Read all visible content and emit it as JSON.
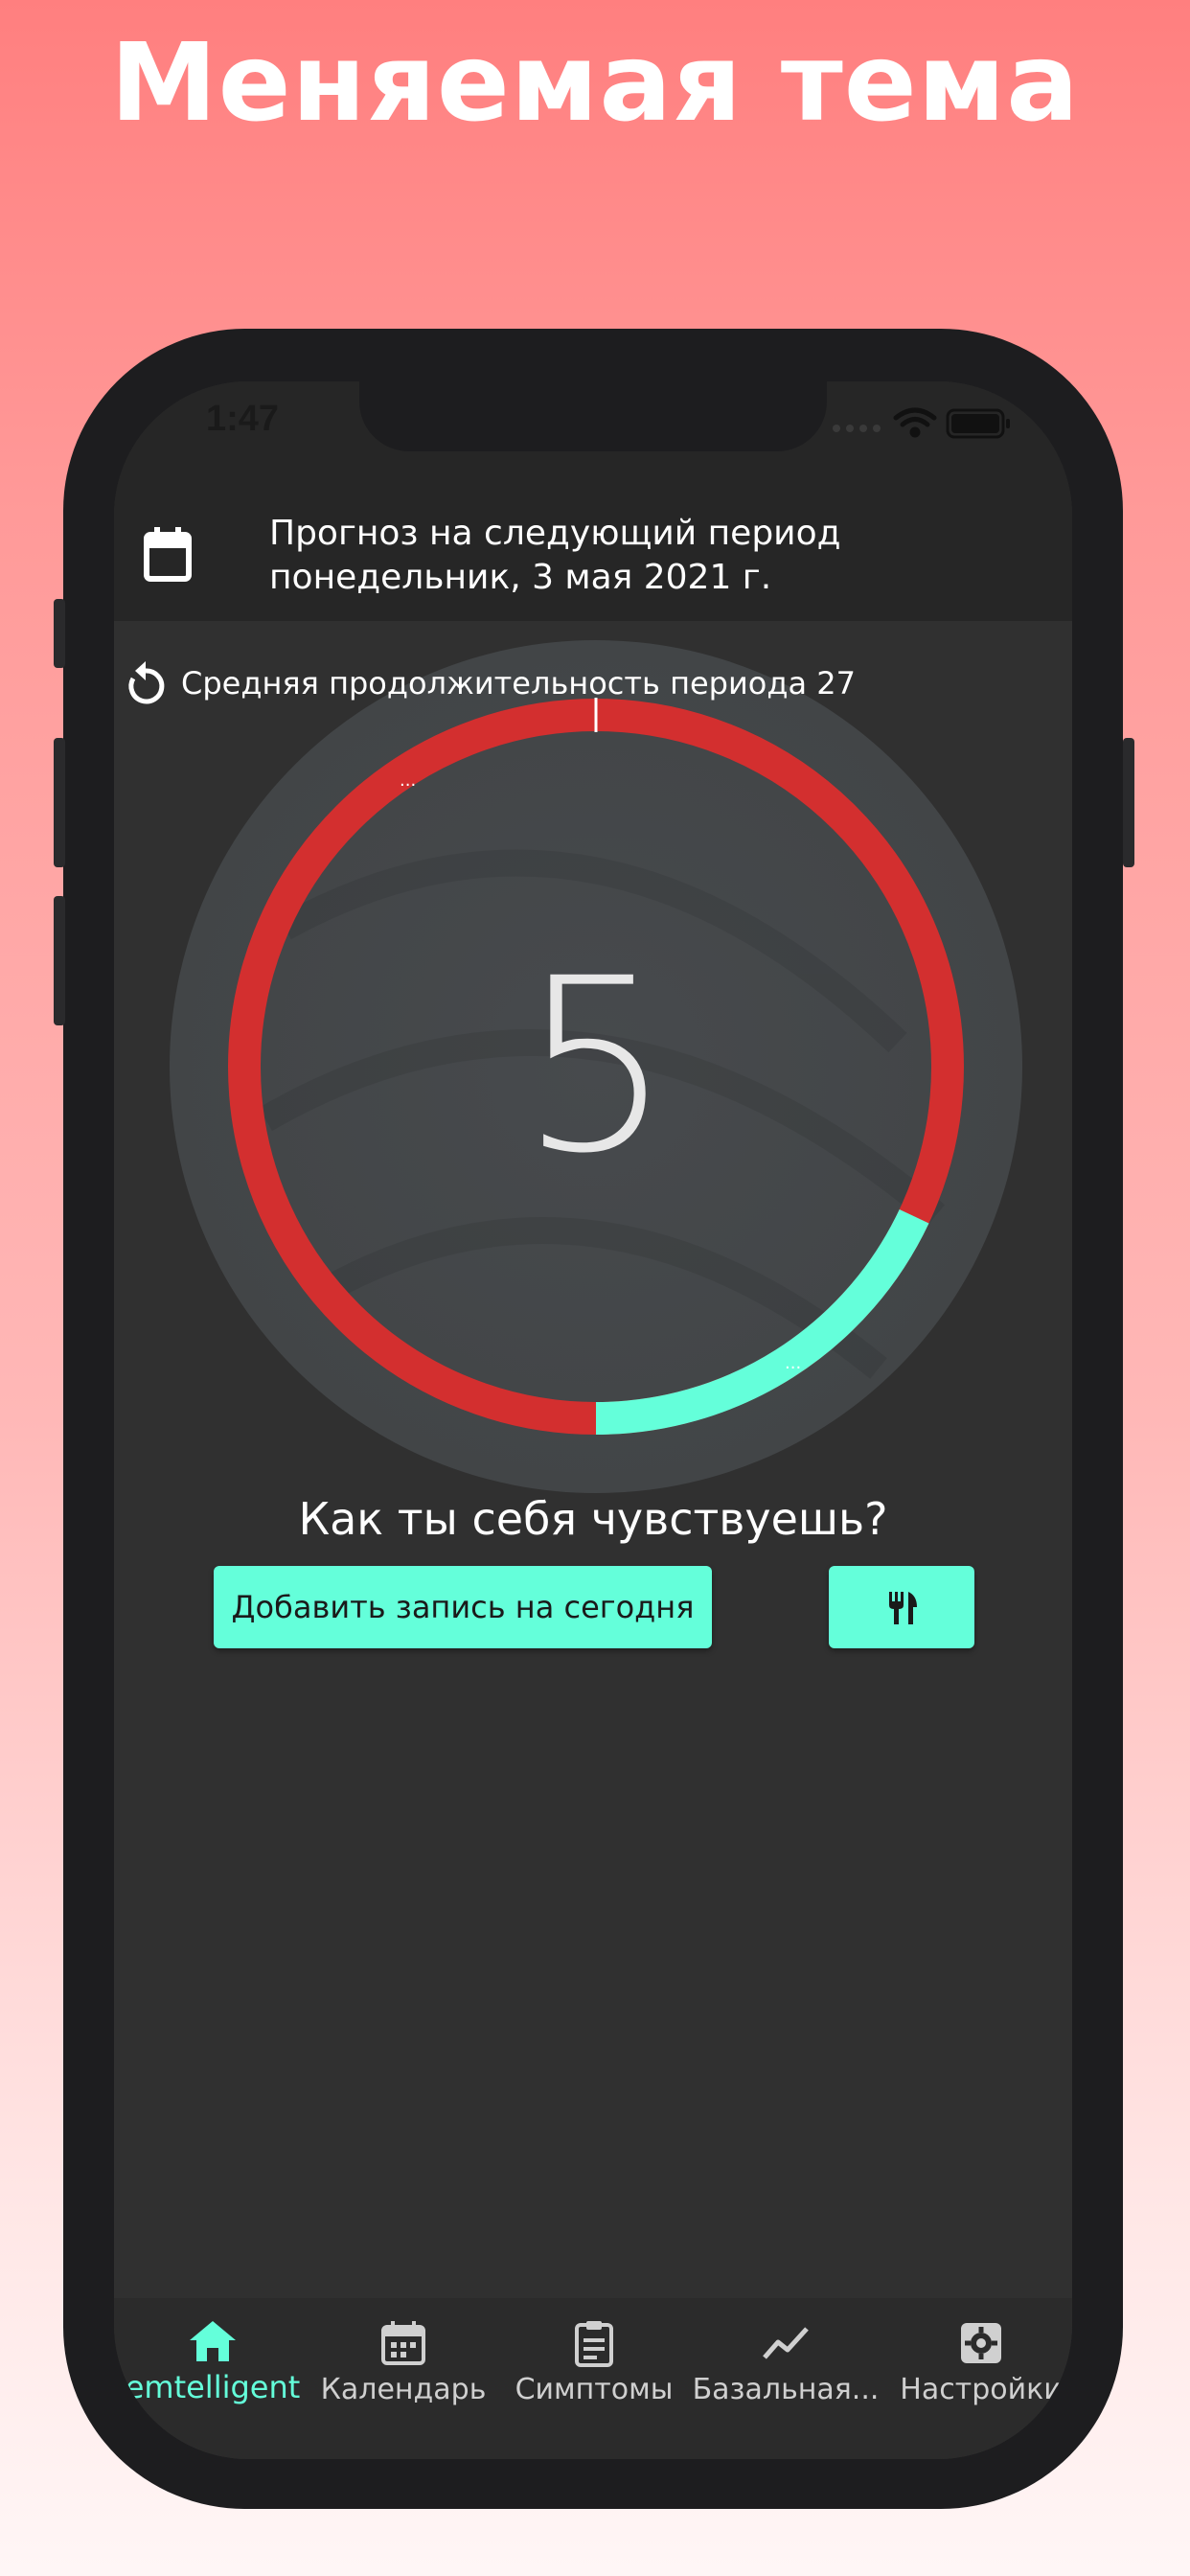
{
  "promo": {
    "title": "Меняемая тема"
  },
  "status_bar": {
    "time": "1:47"
  },
  "header": {
    "forecast_title": "Прогноз на следующий период",
    "forecast_date": "понедельник, 3 мая 2021 г."
  },
  "cycle": {
    "average_label": "Средняя продолжительность периода 27",
    "current_day": "5",
    "average_length": 27,
    "highlighted_fraction": 0.18,
    "colors": {
      "highlight": "#64ffda",
      "remaining": "#d32f2f"
    }
  },
  "feeling": {
    "question": "Как ты себя чувствуешь?",
    "add_button": "Добавить запись на сегодня"
  },
  "nav": {
    "items": [
      {
        "label": "emtelligent",
        "icon": "home-icon",
        "active": true
      },
      {
        "label": "Календарь",
        "icon": "calendar-icon",
        "active": false
      },
      {
        "label": "Симптомы",
        "icon": "clipboard-icon",
        "active": false
      },
      {
        "label": "Базальная...",
        "icon": "trending-icon",
        "active": false
      },
      {
        "label": "Настройки",
        "icon": "settings-icon",
        "active": false
      }
    ]
  },
  "theme": {
    "accent": "#64ffda",
    "background": "#303030",
    "header": "#262626"
  }
}
